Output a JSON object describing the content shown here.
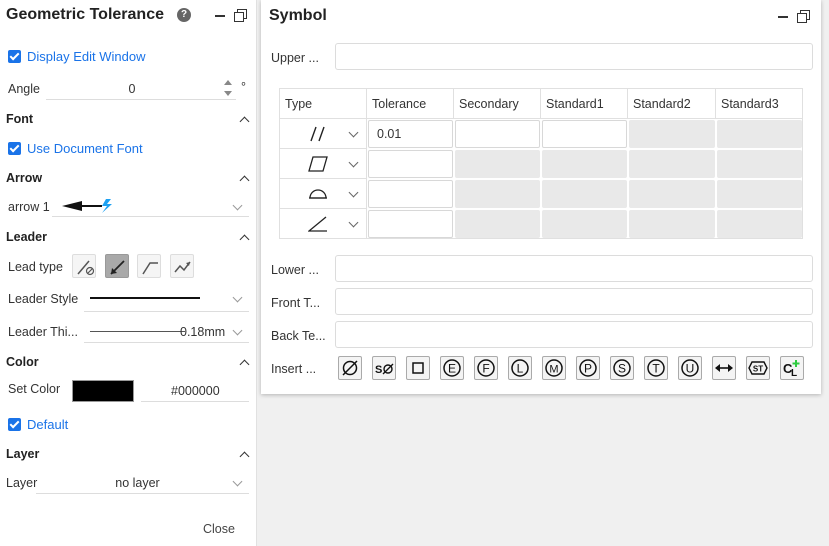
{
  "left_panel": {
    "title": "Geometric Tolerance",
    "help_icon": "?",
    "display_edit_window": "Display Edit Window",
    "angle": {
      "label": "Angle",
      "value": "0",
      "unit": "°"
    },
    "font": {
      "header": "Font",
      "use_document_font": "Use Document Font"
    },
    "arrow": {
      "header": "Arrow",
      "label": "arrow 1"
    },
    "leader": {
      "header": "Leader",
      "lead_type_label": "Lead type",
      "style_label": "Leader Style",
      "thickness_label": "Leader Thi...",
      "thickness_value": "0.18mm"
    },
    "color": {
      "header": "Color",
      "set_color_label": "Set Color",
      "hex": "#000000",
      "swatch": "#000000",
      "default_label": "Default"
    },
    "layer": {
      "header": "Layer",
      "label": "Layer",
      "value": "no layer"
    },
    "close": "Close"
  },
  "symbol_panel": {
    "title": "Symbol",
    "upper_label": "Upper ...",
    "lower_label": "Lower ...",
    "front_label": "Front T...",
    "back_label": "Back Te...",
    "insert_label": "Insert ...",
    "table": {
      "headers": [
        "Type",
        "Tolerance",
        "Secondary",
        "Standard1",
        "Standard2",
        "Standard3"
      ],
      "rows": [
        {
          "type_icon": "parallelism-icon",
          "tolerance": "0.01"
        },
        {
          "type_icon": "flatness-icon",
          "tolerance": ""
        },
        {
          "type_icon": "profile-surface-icon",
          "tolerance": ""
        },
        {
          "type_icon": "angularity-icon",
          "tolerance": ""
        }
      ]
    },
    "insert_symbols": [
      "Ø",
      "SØ",
      "□",
      "E",
      "F",
      "L",
      "M",
      "P",
      "S",
      "T",
      "U",
      "↔",
      "ST",
      "CL"
    ]
  },
  "colors": {
    "accent": "#1a73e8",
    "disabled_cell": "#e9e9e9"
  }
}
